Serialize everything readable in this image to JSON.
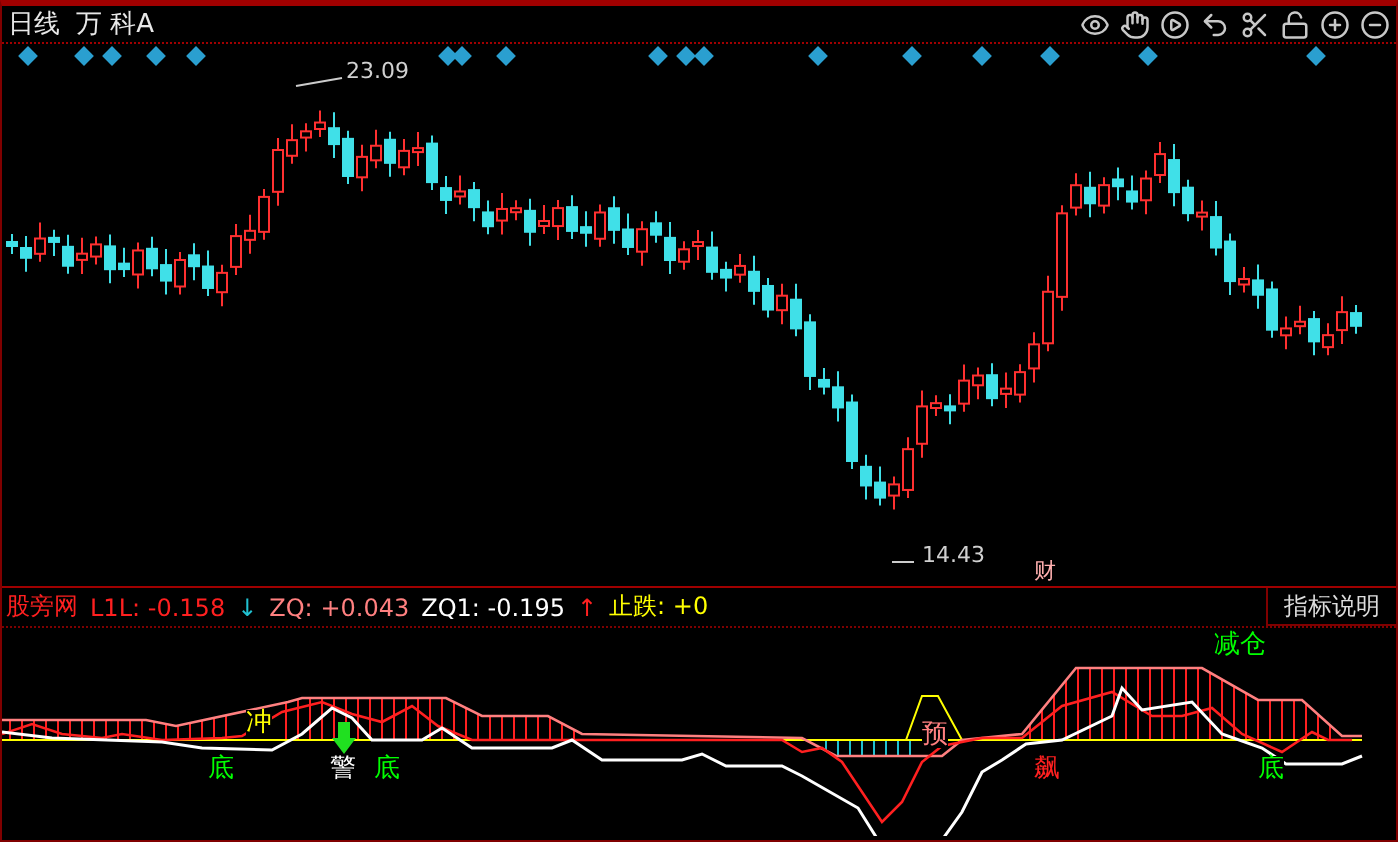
{
  "header": {
    "period": "日线",
    "stock_name": "万 科A"
  },
  "price_labels": {
    "high": "23.09",
    "low": "14.43",
    "note": "财"
  },
  "indicator": {
    "name": "股旁网",
    "values": [
      {
        "label": "L1L:",
        "value": "-0.158",
        "arrow": {
          "symbol": "↓",
          "color": "#20c0d0"
        },
        "color": "#ff2020"
      },
      {
        "label": "ZQ:",
        "value": "+0.043",
        "color": "#ff8080"
      },
      {
        "label": "ZQ1:",
        "value": "-0.195",
        "arrow": {
          "symbol": "↑",
          "color": "#ff2020"
        },
        "color": "#ffffff"
      },
      {
        "label": "止跌:",
        "value": "+0",
        "color": "#ffff00"
      }
    ]
  },
  "help_button": "指标说明",
  "signals": [
    {
      "text": "冲",
      "color": "#ffff00",
      "arrow": false
    },
    {
      "text": "底",
      "color": "#00ff00",
      "arrow": false
    },
    {
      "text": "警",
      "color": "#ffffff",
      "arrow": true
    },
    {
      "text": "底",
      "color": "#00ff00",
      "arrow": false
    },
    {
      "text": "预",
      "color": "#ff8080",
      "arrow": false
    },
    {
      "text": "飙",
      "color": "#ff2020",
      "arrow": false
    },
    {
      "text": "减仓",
      "color": "#00ff00",
      "arrow": false
    },
    {
      "text": "底",
      "color": "#00ff00",
      "arrow": false
    }
  ]
}
